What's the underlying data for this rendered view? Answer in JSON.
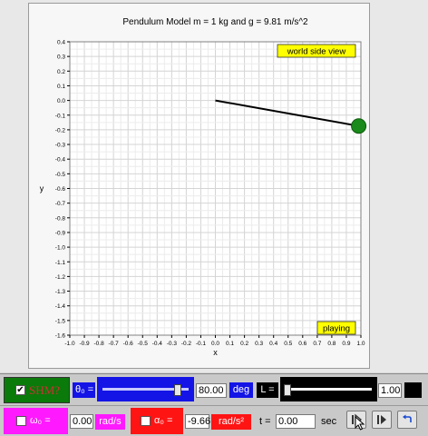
{
  "plot": {
    "title": "Pendulum Model  m = 1 kg and g = 9.81 m/s^2",
    "view_badge": "world side view",
    "status_badge": "playing",
    "xlabel": "x",
    "ylabel": "y",
    "x_ticks": [
      "-1.0",
      "-0.9",
      "-0.8",
      "-0.7",
      "-0.6",
      "-0.5",
      "-0.4",
      "-0.3",
      "-0.2",
      "-0.1",
      "0.0",
      "0.1",
      "0.2",
      "0.3",
      "0.4",
      "0.5",
      "0.6",
      "0.7",
      "0.8",
      "0.9",
      "1.0"
    ],
    "y_ticks": [
      "0.4",
      "0.3",
      "0.2",
      "0.1",
      "0.0",
      "-0.1",
      "-0.2",
      "-0.3",
      "-0.4",
      "-0.5",
      "-0.6",
      "-0.7",
      "-0.8",
      "-0.9",
      "-1.0",
      "-1.1",
      "-1.2",
      "-1.3",
      "-1.4",
      "-1.5",
      "-1.6"
    ],
    "pivot": {
      "x": 0.0,
      "y": 0.0
    },
    "bob": {
      "x": 0.985,
      "y": -0.174
    },
    "xlim": [
      -1.0,
      1.0
    ],
    "ylim": [
      -1.6,
      0.4
    ],
    "colors": {
      "rod": "#000000",
      "bob": "#1a8a1a",
      "badge": "#ffff00"
    }
  },
  "controls": {
    "shm_label": "SHM?",
    "shm_checked": "✔",
    "theta0_label": "θ₀ =",
    "theta0_value": "80.00",
    "theta0_unit": "deg",
    "theta0_slider_fraction": 0.89,
    "length_label": "L =",
    "length_value": "1.00",
    "length_slider_fraction": 0.0,
    "omega0_label": "ω₀ =",
    "omega0_value": "0.00",
    "omega0_unit": "rad/s",
    "alpha0_label": "α₀ =",
    "alpha0_value": "-9.66",
    "alpha0_unit": "rad/s²",
    "time_label": "t =",
    "time_value": "0.00",
    "time_unit": "sec",
    "colors": {
      "shm": "#0a7a0a",
      "theta": "#1414e6",
      "omega": "#ff19ff",
      "alpha": "#ff1414",
      "length": "#000000"
    }
  }
}
